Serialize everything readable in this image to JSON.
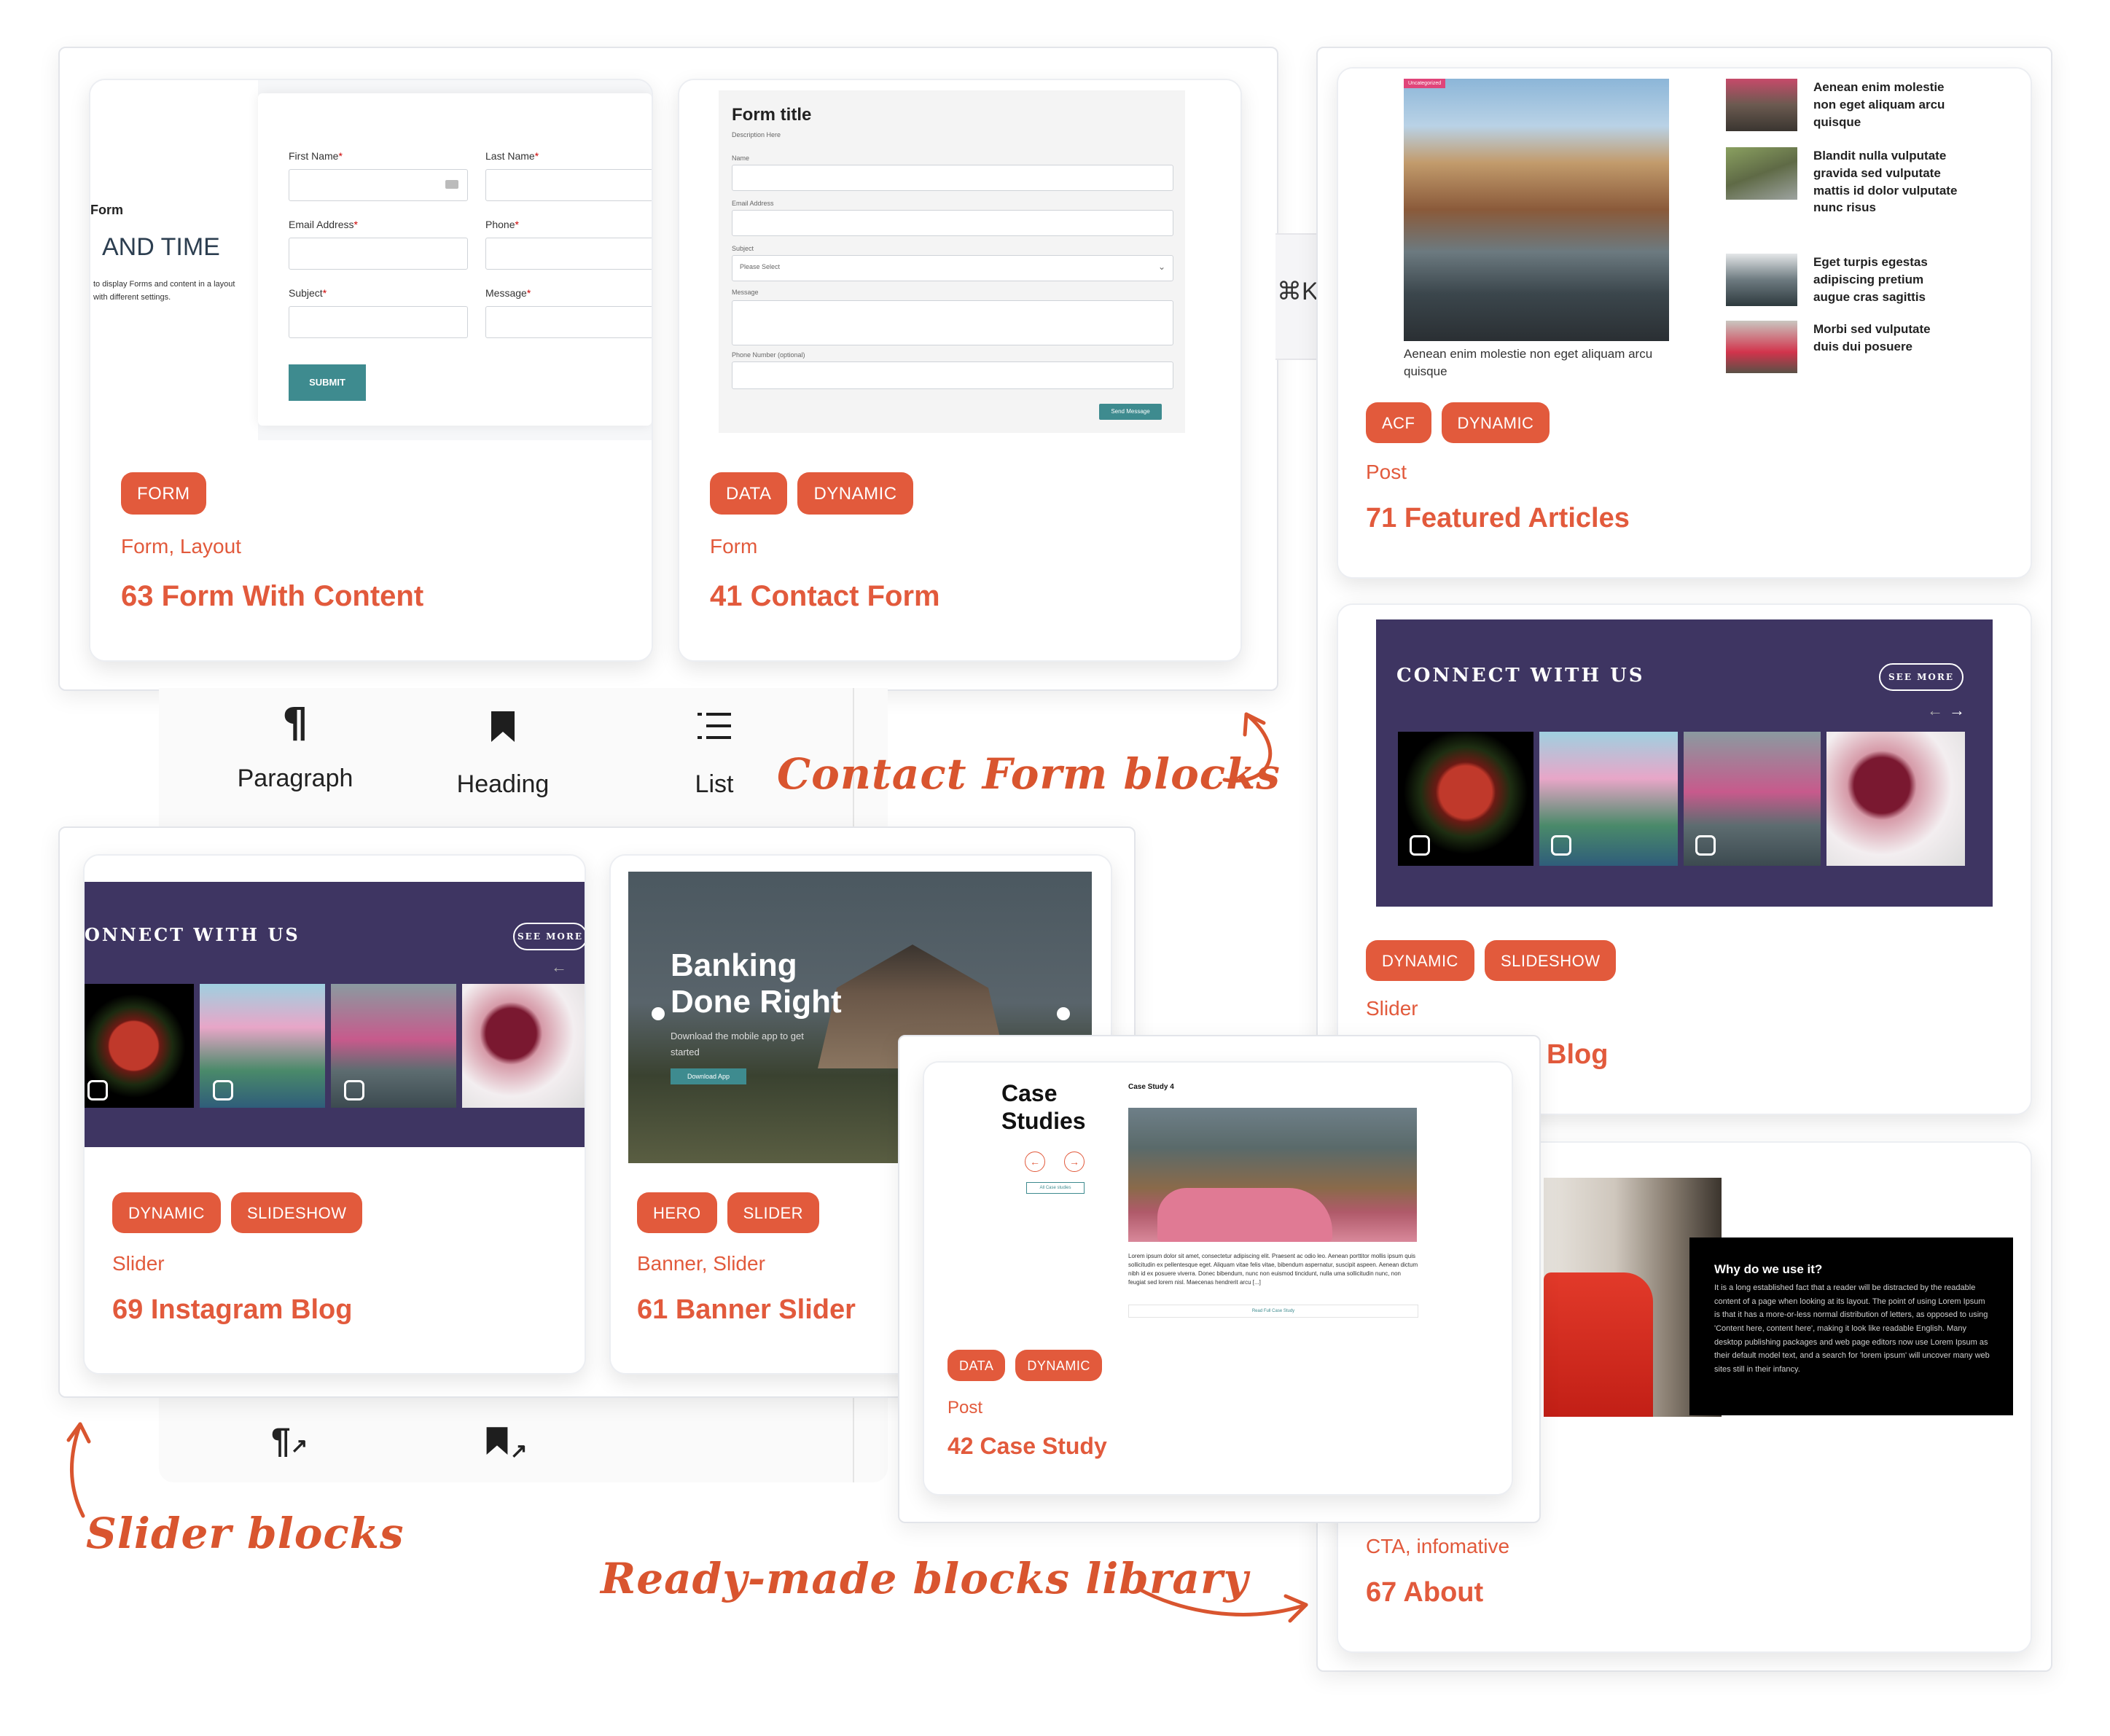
{
  "form_panel": {
    "card1": {
      "form_label": "Form",
      "heading": "AND TIME",
      "desc": "to display Forms and content in a layout with different settings.",
      "first_name": "First Name",
      "last_name": "Last Name",
      "email": "Email Address",
      "phone": "Phone",
      "subject": "Subject",
      "message": "Message",
      "required": "*",
      "submit": "SUBMIT",
      "tags": [
        "FORM"
      ],
      "category": "Form,  Layout",
      "title": "63 Form With Content"
    },
    "card2": {
      "form_title": "Form title",
      "form_desc": "Description Here",
      "name": "Name",
      "email": "Email Address",
      "subject": "Subject",
      "select_placeholder": "Please Select",
      "message": "Message",
      "phone": "Phone Number (optional)",
      "send": "Send Message",
      "tags": [
        "DATA",
        "DYNAMIC"
      ],
      "category": "Form",
      "title": "41 Contact Form"
    }
  },
  "shortcut": "⌘K",
  "block_toolbar": {
    "items": [
      {
        "label": "Paragraph",
        "icon": "paragraph-icon",
        "glyph": "¶"
      },
      {
        "label": "Heading",
        "icon": "bookmark-icon",
        "glyph": "🔖"
      },
      {
        "label": "List",
        "icon": "list-icon",
        "glyph": "☰"
      }
    ]
  },
  "annotations": {
    "contact": "Contact Form blocks",
    "slider": "Slider blocks",
    "library": "Ready-made blocks library"
  },
  "slider_panel": {
    "card1": {
      "connect": "ONNECT WITH US",
      "see_more": "SEE MORE",
      "tags": [
        "DYNAMIC",
        "SLIDESHOW"
      ],
      "category": "Slider",
      "title": "69 Instagram Blog"
    },
    "card2": {
      "headline1": "Banking",
      "headline2": "Done Right",
      "sub1": "Download the mobile app to get",
      "sub2": "started",
      "button": "Download App",
      "tags": [
        "HERO",
        "SLIDER"
      ],
      "category": "Banner,  Slider",
      "title": "61 Banner Slider"
    }
  },
  "right_panel": {
    "featured": {
      "main_badge": "Uncategorized",
      "main_caption": "Aenean enim molestie non eget aliquam arcu quisque",
      "side": [
        "Aenean enim molestie non eget aliquam arcu quisque",
        "Blandit nulla vulputate gravida sed vulputate mattis id dolor vulputate nunc risus",
        "Eget turpis egestas adipiscing pretium augue cras sagittis",
        "Morbi sed vulputate duis dui posuere"
      ],
      "tags": [
        "ACF",
        "DYNAMIC"
      ],
      "category": "Post",
      "title": "71 Featured Articles"
    },
    "insta": {
      "connect": "CONNECT WITH US",
      "see_more": "SEE MORE",
      "tags": [
        "DYNAMIC",
        "SLIDESHOW"
      ],
      "category": "Slider",
      "title_fragment": "Blog"
    },
    "about": {
      "box_title": "Why do we use it?",
      "box_text": "It is a long established fact that a reader will be distracted by the readable content of a page when looking at its layout. The point of using Lorem Ipsum is that it has a more-or-less normal distribution of letters, as opposed to using 'Content here, content here', making it look like readable English. Many desktop publishing packages and web page editors now use Lorem Ipsum as their default model text, and a search for 'lorem ipsum' will uncover many web sites still in their infancy.",
      "category": "CTA,  infomative",
      "title": "67 About"
    }
  },
  "case_study": {
    "heading1": "Case",
    "heading2": "Studies",
    "all_link": "All Case studies",
    "item_title": "Case Study 4",
    "body": "Lorem ipsum dolor sit amet, consectetur adipiscing elit. Praesent ac odio leo. Aenean porttitor mollis ipsum quis sollicitudin ex pellentesque eget. Aliquam vitae felis vitae, bibendum aspernatur, suscipit aspeen. Aenean dictum nibh id ex posuere viverra. Donec bibendum, nunc non euismod tincidunt, nulla uma sollicitudin nunc, non feugiat sed lorem nisl. Maecenas hendrerit arcu [...]",
    "read_link": "Read Full Case Study",
    "tags": [
      "DATA",
      "DYNAMIC"
    ],
    "category": "Post",
    "title": "42 Case Study"
  },
  "colors": {
    "accent": "#e25a3c",
    "purple": "#3e3562",
    "teal": "#3e8b8f"
  }
}
